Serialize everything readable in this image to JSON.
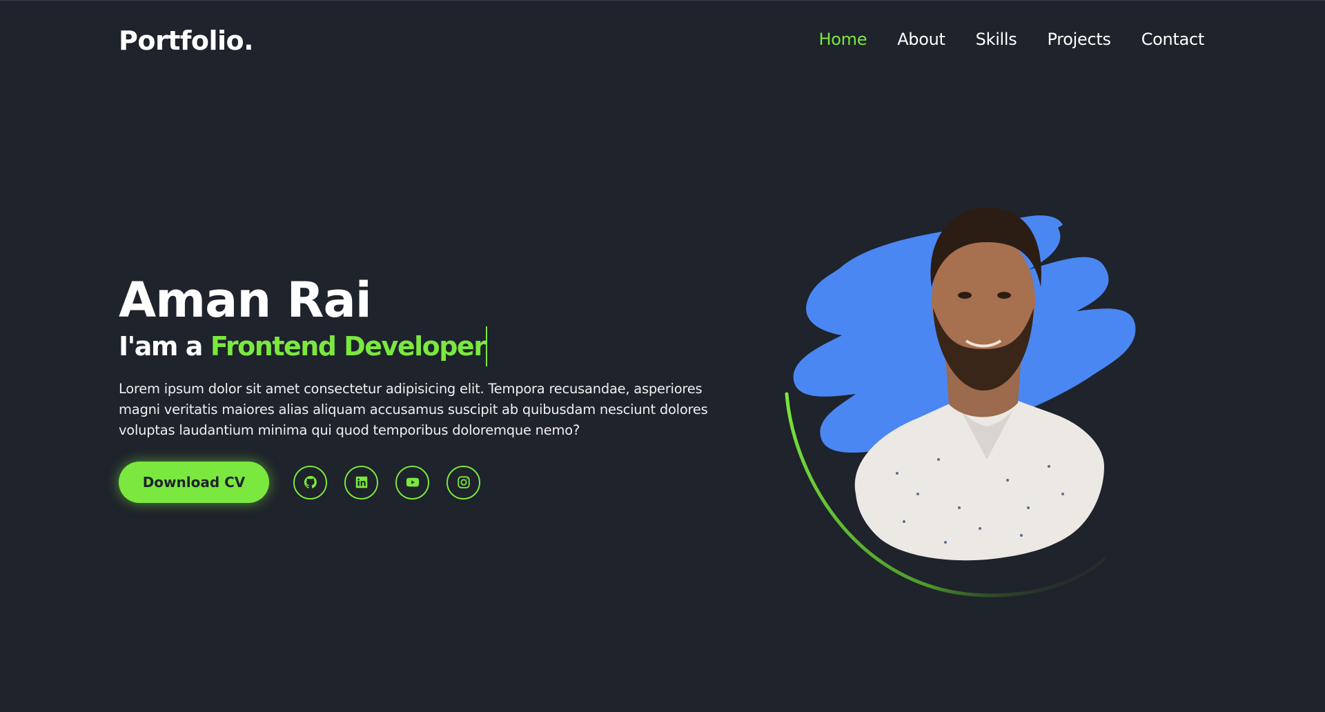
{
  "header": {
    "logo": "Portfolio.",
    "nav": [
      {
        "label": "Home",
        "active": true
      },
      {
        "label": "About",
        "active": false
      },
      {
        "label": "Skills",
        "active": false
      },
      {
        "label": "Projects",
        "active": false
      },
      {
        "label": "Contact",
        "active": false
      }
    ]
  },
  "hero": {
    "name": "Aman Rai",
    "role_prefix": "I'am a",
    "role_highlight": "Frontend Developer",
    "description": "Lorem ipsum dolor sit amet consectetur adipisicing elit. Tempora recusandae, asperiores magni veritatis maiores alias aliquam accusamus suscipit ab quibusdam nesciunt dolores voluptas laudantium minima qui quod temporibus doloremque nemo?",
    "cta_label": "Download CV",
    "socials": [
      {
        "name": "github-icon"
      },
      {
        "name": "linkedin-icon"
      },
      {
        "name": "youtube-icon"
      },
      {
        "name": "instagram-icon"
      }
    ]
  },
  "colors": {
    "background": "#1f232b",
    "accent": "#7be83f",
    "brush": "#4a87f2",
    "text": "#ffffff"
  }
}
